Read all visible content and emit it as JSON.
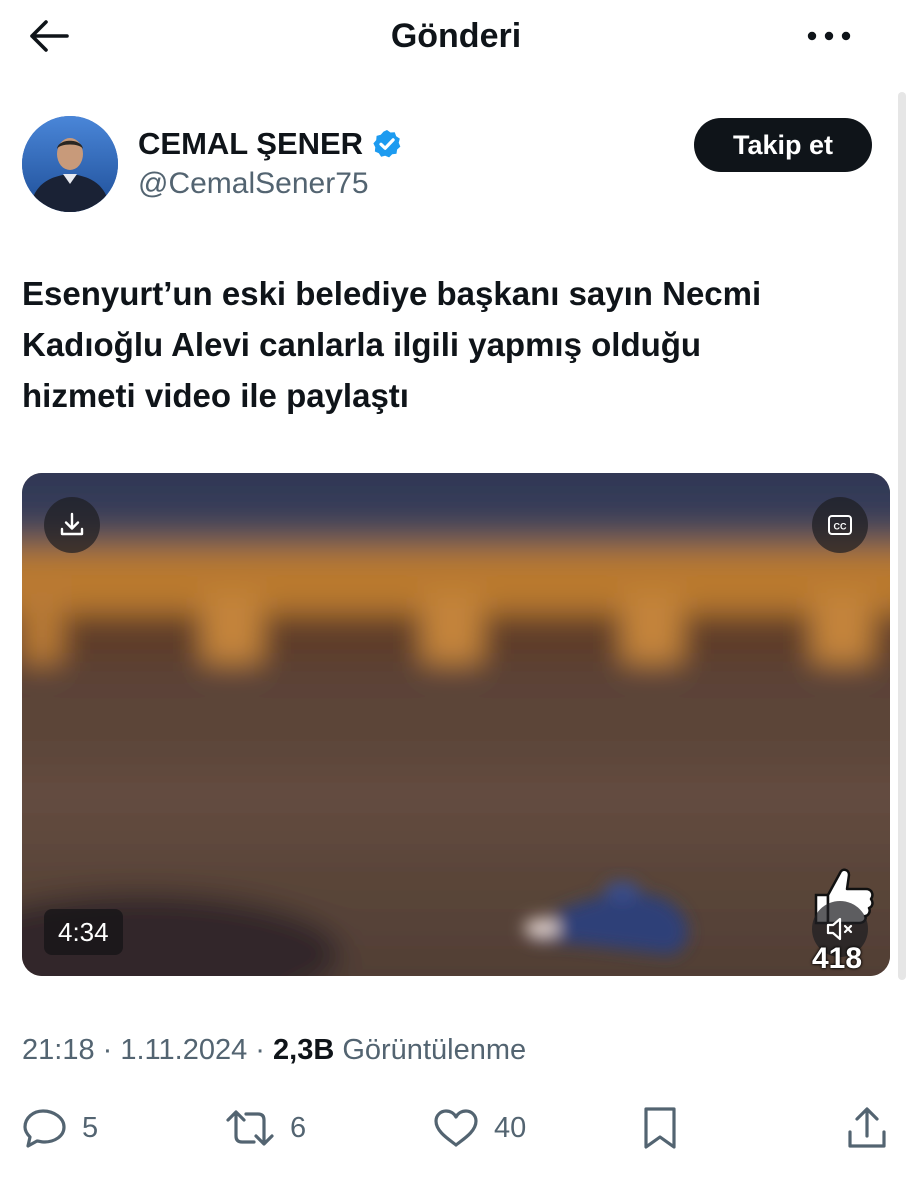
{
  "header": {
    "title": "Gönderi",
    "back_icon": "arrow-left-icon",
    "more_icon": "more-horizontal-icon"
  },
  "author": {
    "display_name": "CEMAL ŞENER",
    "handle": "@CemalSener75",
    "verified": true,
    "verified_color": "#1d9bf0",
    "follow_label": "Takip et"
  },
  "post": {
    "text": "Esenyurt’un eski  belediye başkanı sayın Necmi\nKadıoğlu Alevi canlarla ilgili yapmış olduğu\nhizmeti video ile paylaştı"
  },
  "video": {
    "duration": "4:34",
    "overlay_count": "418",
    "download_icon": "download-icon",
    "captions_icon": "captions-icon",
    "mute_icon": "mute-icon",
    "like_overlay_icon": "thumbs-up-icon"
  },
  "meta": {
    "time": "21:18",
    "separator": " · ",
    "date": "1.11.2024",
    "views": "2,3B",
    "views_label": " Görüntülenme"
  },
  "actions": {
    "replies": "5",
    "reposts": "6",
    "likes": "40"
  },
  "colors": {
    "text": "#0f1419",
    "secondary": "#536471",
    "button_bg": "#0f1419"
  }
}
